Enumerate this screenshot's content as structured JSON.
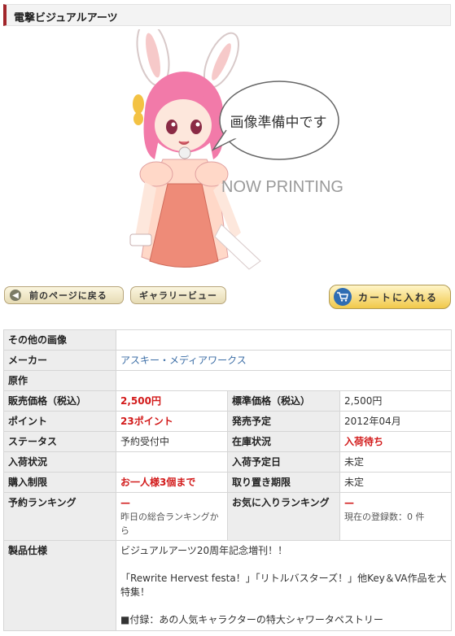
{
  "header": {
    "title": "電撃ビジュアルアーツ"
  },
  "image": {
    "bubble_text": "画像準備中です",
    "now_printing": "NOW PRINTING"
  },
  "buttons": {
    "back": "前のページに戻る",
    "gallery": "ギャラリービュー",
    "cart": "カートに入れる"
  },
  "table": {
    "other_images": {
      "label": "その他の画像",
      "value": ""
    },
    "maker": {
      "label": "メーカー",
      "value": "アスキー・メディアワークス"
    },
    "original": {
      "label": "原作",
      "value": ""
    },
    "price": {
      "label": "販売価格（税込）",
      "value": "2,500円"
    },
    "std_price": {
      "label": "標準価格（税込）",
      "value": "2,500円"
    },
    "points": {
      "label": "ポイント",
      "value": "23ポイント"
    },
    "release": {
      "label": "発売予定",
      "value": "2012年04月"
    },
    "status": {
      "label": "ステータス",
      "value": "予約受付中"
    },
    "stock": {
      "label": "在庫状況",
      "value": "入荷待ち"
    },
    "arrival": {
      "label": "入荷状況",
      "value": ""
    },
    "arrival_date": {
      "label": "入荷予定日",
      "value": "未定"
    },
    "limit": {
      "label": "購入制限",
      "value": "お一人様3個まで"
    },
    "hold": {
      "label": "取り置き期限",
      "value": "未定"
    },
    "reserve_rank": {
      "label": "予約ランキング",
      "value": "—",
      "note": "昨日の総合ランキングから"
    },
    "fav_rank": {
      "label": "お気に入りランキング",
      "value": "—",
      "note": "現在の登録数：0 件"
    },
    "spec": {
      "label": "製品仕様",
      "line1": "ビジュアルアーツ20周年記念増刊！！",
      "line2": "「Rewrite Hervest festa！」「リトルバスターズ！」他Key＆VA作品を大特集！",
      "line3": "■付録：あの人気キャラクターの特大シャワータペストリー"
    }
  },
  "colors": {
    "accent": "#a1252a",
    "red": "#d21a1a",
    "link": "#3c6ea6",
    "label_bg": "#ededed"
  }
}
